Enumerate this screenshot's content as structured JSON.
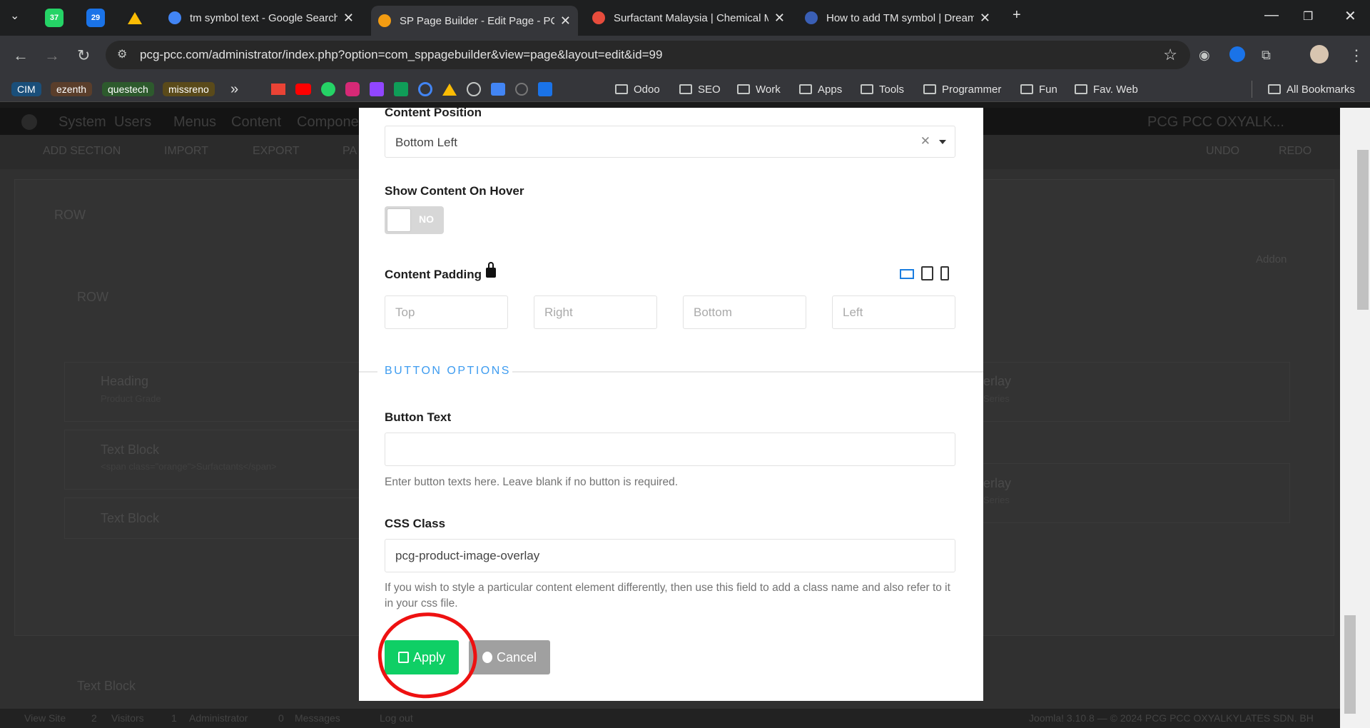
{
  "tabs": [
    {
      "title": "tm symbol text - Google Search",
      "fav": "#4285f4"
    },
    {
      "title": "SP Page Builder - Edit Page - PC",
      "fav": "#f39c12",
      "active": true
    },
    {
      "title": "Surfactant Malaysia | Chemical M",
      "fav": "#e74c3c"
    },
    {
      "title": "How to add TM symbol | Dream",
      "fav": "#3a5fb5"
    }
  ],
  "pinned": [
    "37",
    "29"
  ],
  "url": "pcg-pcc.com/administrator/index.php?option=com_sppagebuilder&view=page&layout=edit&id=99",
  "bookmarks": {
    "chips": [
      {
        "label": "CIM",
        "color": "#1a4f7a"
      },
      {
        "label": "ezenth",
        "color": "#5a3e2b"
      },
      {
        "label": "questech",
        "color": "#2d5a2d"
      },
      {
        "label": "missreno",
        "color": "#5a4a1a"
      }
    ],
    "more": "»",
    "folders": [
      "Odoo",
      "SEO",
      "Work",
      "Apps",
      "Tools",
      "Programmer",
      "Fun",
      "Fav. Web"
    ],
    "all": "All Bookmarks"
  },
  "background": {
    "nav": [
      "System",
      "Users",
      "Menus",
      "Content",
      "Compone"
    ],
    "site": "PCG PCC OXYALK...",
    "toolbar": [
      "ADD SECTION",
      "IMPORT",
      "EXPORT",
      "PA"
    ],
    "undo": "UNDO",
    "redo": "REDO",
    "row1": "ROW",
    "row2": "ROW",
    "addon": "Addon",
    "heading": "Heading",
    "heading_sub": "Product Grade",
    "textblock": "Text Block",
    "textblock_sub": "<span class=\"orange\">Surfactants</span>",
    "overlay": "erlay",
    "overlay_sub": "Series",
    "footer": [
      "View Site",
      "2",
      "Visitors",
      "1",
      "Administrator",
      "0",
      "Messages",
      "Log out"
    ],
    "footer_right": "Joomla! 3.10.8  —  © 2024 PCG PCC OXYALKYLATES SDN. BH"
  },
  "modal": {
    "content_position_label": "Content Position",
    "content_position_value": "Bottom Left",
    "show_hover_label": "Show Content On Hover",
    "toggle_text": "NO",
    "content_padding_label": "Content Padding",
    "padding_placeholders": [
      "Top",
      "Right",
      "Bottom",
      "Left"
    ],
    "section_title": "BUTTON OPTIONS",
    "button_text_label": "Button Text",
    "button_text_value": "",
    "button_text_help": "Enter button texts here. Leave blank if no button is required.",
    "css_class_label": "CSS Class",
    "css_class_value": "pcg-product-image-overlay",
    "css_class_help": "If you wish to style a particular content element differently, then use this field to add a class name and also refer to it in your css file.",
    "apply": "Apply",
    "cancel": "Cancel"
  },
  "colors": {
    "apply": "#0fcf65",
    "cancel": "#a0a0a0",
    "section": "#3e9cf0",
    "annotation": "#e11"
  }
}
